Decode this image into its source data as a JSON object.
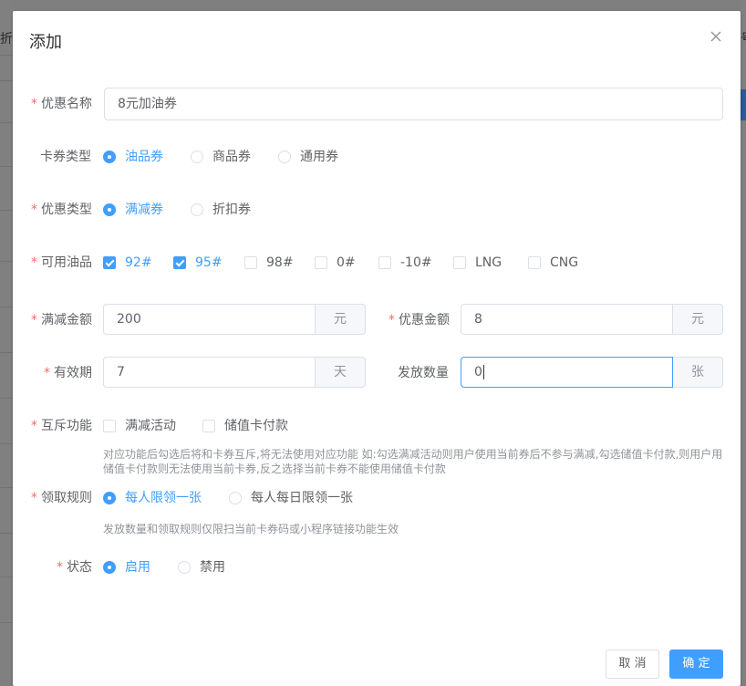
{
  "background": {
    "left_fragment": "折",
    "right_fragment": "号"
  },
  "dialog": {
    "title": "添加"
  },
  "form": {
    "name": {
      "label": "优惠名称",
      "value": "8元加油券"
    },
    "card_type": {
      "label": "卡券类型",
      "options": [
        "油品券",
        "商品券",
        "通用券"
      ],
      "selected": "油品券"
    },
    "discount_type": {
      "label": "优惠类型",
      "options": [
        "满减券",
        "折扣券"
      ],
      "selected": "满减券"
    },
    "oil": {
      "label": "可用油品",
      "options": [
        "92#",
        "95#",
        "98#",
        "0#",
        "-10#",
        "LNG",
        "CNG"
      ],
      "checked": [
        "92#",
        "95#"
      ]
    },
    "threshold": {
      "label": "满减金额",
      "value": "200",
      "unit": "元"
    },
    "amount": {
      "label": "优惠金额",
      "value": "8",
      "unit": "元"
    },
    "validity": {
      "label": "有效期",
      "value": "7",
      "unit": "天"
    },
    "quantity": {
      "label": "发放数量",
      "value": "0",
      "unit": "张"
    },
    "exclusive": {
      "label": "互斥功能",
      "options": [
        "满减活动",
        "储值卡付款"
      ],
      "hint_line1": "对应功能后勾选后将和卡券互斥,将无法使用对应功能 如:勾选满减活动则用户使用当前券后不参与满减,勾选储值卡付款,则用户用",
      "hint_line2": "储值卡付款则无法使用当前卡券,反之选择当前卡券不能使用储值卡付款"
    },
    "rule": {
      "label": "领取规则",
      "options": [
        "每人限领一张",
        "每人每日限领一张"
      ],
      "selected": "每人限领一张",
      "hint": "发放数量和领取规则仅限扫当前卡券码或小程序链接功能生效"
    },
    "status": {
      "label": "状态",
      "options": [
        "启用",
        "禁用"
      ],
      "selected": "启用"
    }
  },
  "footer": {
    "cancel_label": "取 消",
    "confirm_label": "确 定"
  },
  "colors": {
    "primary": "#409eff",
    "required": "#f56c6c"
  }
}
